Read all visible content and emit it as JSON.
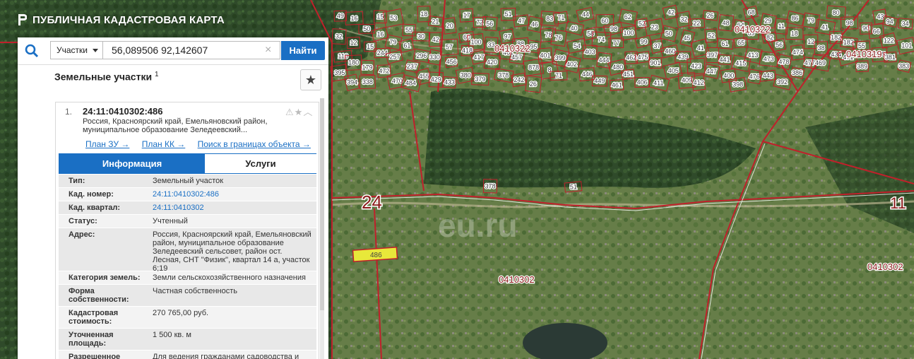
{
  "app": {
    "title": "ПУБЛИЧНАЯ КАДАСТРОВАЯ КАРТА"
  },
  "search": {
    "type": "Участки",
    "query": "56,089506 92,142607",
    "button": "Найти"
  },
  "section": {
    "title": "Земельные участки",
    "count": "1"
  },
  "result": {
    "num": "1.",
    "code": "24:11:0410302:486",
    "address": "Россия, Красноярский край, Емельяновский район, муниципальное образование Зеледеевский...",
    "links": [
      "План ЗУ →",
      "План КК →",
      "Поиск в границах объекта →"
    ],
    "tabs": {
      "info": "Информация",
      "services": "Услуги"
    },
    "properties": [
      {
        "k": "Тип:",
        "v": "Земельный участок"
      },
      {
        "k": "Кад. номер:",
        "v": "24:11:0410302:486",
        "link": true
      },
      {
        "k": "Кад. квартал:",
        "v": "24:11:0410302",
        "link": true
      },
      {
        "k": "Статус:",
        "v": "Учтенный"
      },
      {
        "k": "Адрес:",
        "v": "Россия, Красноярский край, Емельяновский район, муниципальное образование Зеледеевский сельсовет, район ост. Лесная, СНТ \"Физик\", квартал 14 а, участок 6;19"
      },
      {
        "k": "Категория земель:",
        "v": "Земли сельскохозяйственного назначения"
      },
      {
        "k": "Форма собственности:",
        "v": "Частная собственность"
      },
      {
        "k": "Кадастровая стоимость:",
        "v": "270 765,00 руб."
      },
      {
        "k": "Уточненная площадь:",
        "v": "1 500 кв. м"
      },
      {
        "k": "Разрешенное использование:",
        "v": "Для ведения гражданами садоводства и огородничества"
      }
    ]
  },
  "map": {
    "district_labels": [
      "24",
      "11"
    ],
    "quarter_labels": [
      "0410322",
      "0410322",
      "0410319",
      "0410302",
      "0410302"
    ],
    "selected_parcel": "486",
    "parcels": [
      "49",
      "16",
      "50",
      "15",
      "53",
      "55",
      "18",
      "21",
      "20",
      "17",
      "72",
      "56",
      "51",
      "47",
      "46",
      "83",
      "71",
      "40",
      "44",
      "60",
      "98",
      "62",
      "52",
      "23",
      "42",
      "32",
      "22",
      "26",
      "48",
      "64",
      "68",
      "29",
      "11",
      "86",
      "79",
      "41",
      "80",
      "98",
      "90",
      "43",
      "94",
      "34",
      "32",
      "12",
      "15",
      "16",
      "79",
      "61",
      "30",
      "42",
      "57",
      "60",
      "100",
      "33",
      "97",
      "88",
      "95",
      "78",
      "76",
      "54",
      "58",
      "74",
      "77",
      "100",
      "99",
      "37",
      "50",
      "45",
      "41",
      "52",
      "61",
      "65",
      "69",
      "82",
      "56",
      "18",
      "12",
      "38",
      "182",
      "182",
      "55",
      "66",
      "122",
      "101",
      "110",
      "180",
      "179",
      "244",
      "257",
      "237",
      "296",
      "330",
      "456",
      "418",
      "417",
      "420",
      "461",
      "457",
      "878",
      "401",
      "399",
      "402",
      "403",
      "444",
      "480",
      "462",
      "475",
      "901",
      "460",
      "439",
      "423",
      "397",
      "441",
      "415",
      "413",
      "473",
      "478",
      "474",
      "477",
      "469",
      "434",
      "471",
      "389",
      "385",
      "381",
      "383",
      "395",
      "394",
      "338",
      "472",
      "470",
      "484",
      "455",
      "429",
      "433",
      "380",
      "379",
      "378",
      "378",
      "242",
      "26",
      "8",
      "71",
      "51",
      "446",
      "449",
      "461",
      "451",
      "406",
      "411",
      "405",
      "409",
      "412",
      "447",
      "400",
      "398",
      "476",
      "443",
      "392",
      "386"
    ],
    "watermark": "eu.ru"
  }
}
